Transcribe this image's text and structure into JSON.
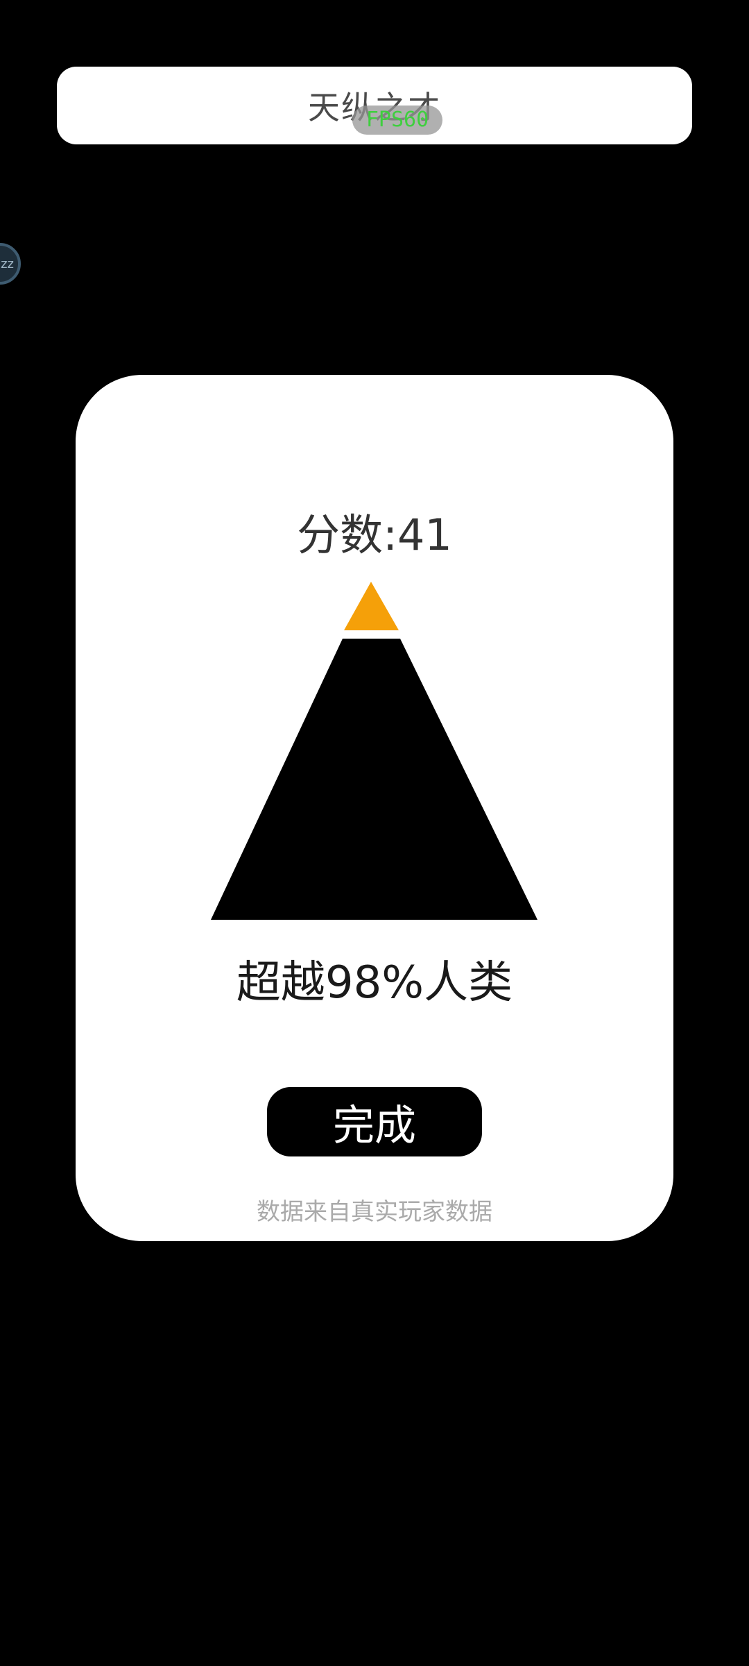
{
  "header": {
    "title": "天纵之才"
  },
  "overlay": {
    "fps_label": "FPS60",
    "side_bubble_text": "zz"
  },
  "result_card": {
    "score_label": "分数:41",
    "beat_text": "超越98%人类",
    "done_label": "完成",
    "footnote": "数据来自真实玩家数据",
    "pyramid": {
      "highlight_color": "#f5a009",
      "base_color": "#000000"
    }
  }
}
